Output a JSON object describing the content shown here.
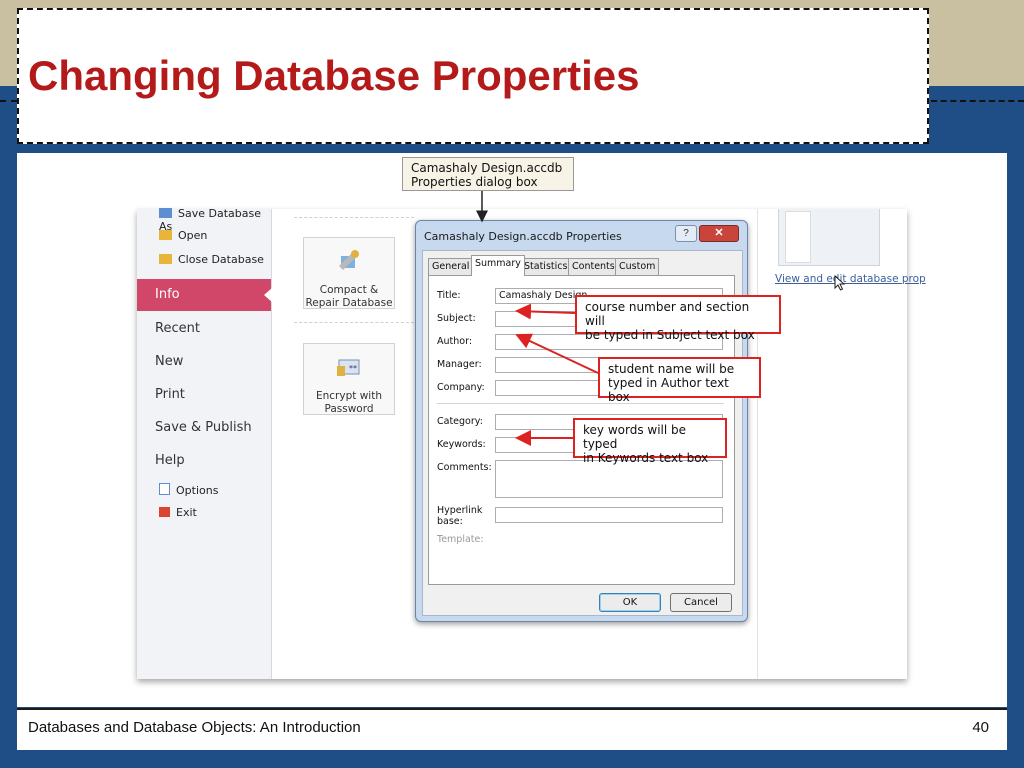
{
  "slide": {
    "title": "Changing Database Properties",
    "footer": "Databases and Database Objects: An Introduction",
    "page_number": "40"
  },
  "sidebar": {
    "save_as": "Save Database As",
    "open": "Open",
    "close": "Close Database",
    "info": "Info",
    "recent": "Recent",
    "new": "New",
    "print": "Print",
    "save_publish": "Save & Publish",
    "help": "Help",
    "options": "Options",
    "exit": "Exit"
  },
  "commands": {
    "compact_line1": "Compact &",
    "compact_line2": "Repair Database",
    "encrypt_line1": "Encrypt with",
    "encrypt_line2": "Password"
  },
  "right_pane": {
    "link": "View and edit database prop"
  },
  "dialog": {
    "title": "Camashaly Design.accdb Properties",
    "help_label": "?",
    "close_label": "✕",
    "tabs": [
      "General",
      "Summary",
      "Statistics",
      "Contents",
      "Custom"
    ],
    "active_tab": "Summary",
    "fields": {
      "title_label": "Title:",
      "title_value": "Camashaly Design",
      "subject_label": "Subject:",
      "author_label": "Author:",
      "manager_label": "Manager:",
      "company_label": "Company:",
      "category_label": "Category:",
      "keywords_label": "Keywords:",
      "comments_label": "Comments:",
      "hyperlink_label_1": "Hyperlink",
      "hyperlink_label_2": "base:",
      "template_label": "Template:"
    },
    "ok_label": "OK",
    "cancel_label": "Cancel"
  },
  "callouts": {
    "top_line1": "Camashaly Design.accdb",
    "top_line2": "Properties dialog box",
    "subject_line1": "course number and section will",
    "subject_line2": "be typed in Subject text box",
    "author_line1": "student name will be",
    "author_line2": "typed in Author text box",
    "keywords_line1": "key words will be typed",
    "keywords_line2": "in Keywords text box"
  },
  "colors": {
    "title_red": "#b41a1a",
    "slide_blue": "#1f4e86",
    "tan": "#c8c0a0",
    "info_pink": "#d1476a",
    "callout_red": "#dd2222"
  }
}
